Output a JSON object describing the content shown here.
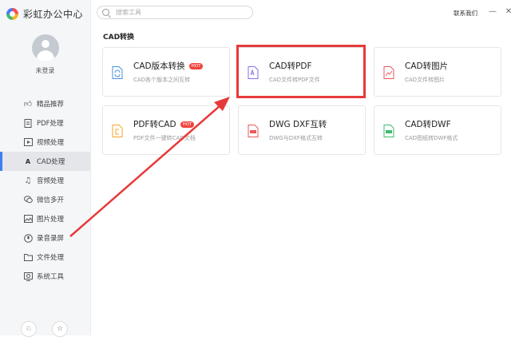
{
  "app": {
    "title": "彩虹办公中心"
  },
  "sidebar": {
    "login_text": "未登录",
    "items": [
      {
        "label": "精品推荐",
        "icon": "thumbs-up-icon"
      },
      {
        "label": "PDF处理",
        "icon": "pdf-icon"
      },
      {
        "label": "视频处理",
        "icon": "video-icon"
      },
      {
        "label": "CAD处理",
        "icon": "cad-icon",
        "active": true
      },
      {
        "label": "音频处理",
        "icon": "music-icon"
      },
      {
        "label": "微信多开",
        "icon": "wechat-icon"
      },
      {
        "label": "图片处理",
        "icon": "image-icon"
      },
      {
        "label": "录音录屏",
        "icon": "record-icon"
      },
      {
        "label": "文件处理",
        "icon": "folder-icon"
      },
      {
        "label": "系统工具",
        "icon": "system-icon"
      }
    ]
  },
  "header": {
    "search_placeholder": "搜索工具",
    "contact": "联系我们"
  },
  "main": {
    "section_title": "CAD转换",
    "cards": [
      {
        "title": "CAD版本转换",
        "desc": "CAD各个版本之间互转",
        "hot": "HOT",
        "color": "#4a90e2"
      },
      {
        "title": "CAD转PDF",
        "desc": "CAD文件转PDF文件",
        "hot": "",
        "color": "#8a6de9"
      },
      {
        "title": "CAD转图片",
        "desc": "CAD文件转图片",
        "hot": "",
        "color": "#e85a5a"
      },
      {
        "title": "PDF转CAD",
        "desc": "PDF文件一键转CAD文档",
        "hot": "HOT",
        "color": "#f5a623"
      },
      {
        "title": "DWG DXF互转",
        "desc": "DWG与DXF格式互转",
        "hot": "",
        "color": "#e85a5a"
      },
      {
        "title": "CAD转DWF",
        "desc": "CAD图纸转DWF格式",
        "hot": "",
        "color": "#3dbb6e"
      }
    ]
  },
  "annotation": {
    "highlight_color": "#e63a3a"
  }
}
